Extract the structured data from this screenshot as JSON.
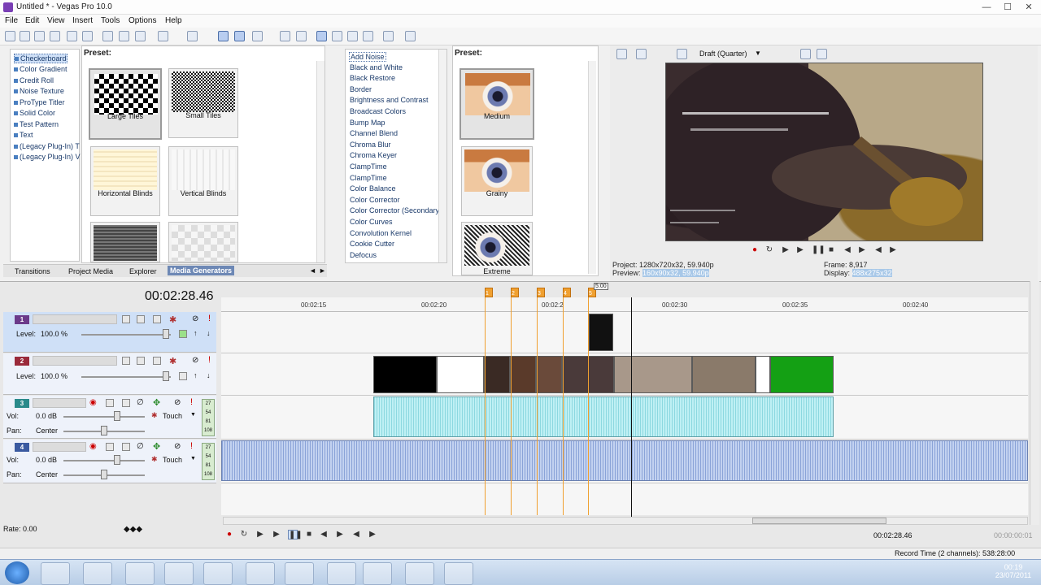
{
  "window": {
    "title": "Untitled * - Vegas Pro 10.0",
    "minimize": "—",
    "maximize": "☐",
    "close": "✕"
  },
  "menu": [
    "File",
    "Edit",
    "View",
    "Insert",
    "Tools",
    "Options",
    "Help"
  ],
  "generators_tree": [
    "Checkerboard",
    "Color Gradient",
    "Credit Roll",
    "Noise Texture",
    "ProType Titler",
    "Solid Color",
    "Test Pattern",
    "Text",
    "(Legacy Plug-In) T",
    "(Legacy Plug-In) V"
  ],
  "generators_preset_label": "Preset:",
  "generator_presets": [
    "Large Tiles",
    "Small Tiles",
    "Horizontal Blinds",
    "Vertical Blinds"
  ],
  "tabs": [
    "Transitions",
    "Project Media",
    "Explorer",
    "Media Generators"
  ],
  "fx_list": [
    "Add Noise",
    "Black and White",
    "Black Restore",
    "Border",
    "Brightness and Contrast",
    "Broadcast Colors",
    "Bump Map",
    "Channel Blend",
    "Chroma Blur",
    "Chroma Keyer",
    "ClampTime",
    "ClampTime",
    "Color Balance",
    "Color Corrector",
    "Color Corrector (Secondary)",
    "Color Curves",
    "Convolution Kernel",
    "Cookie Cutter",
    "Defocus",
    "Deform"
  ],
  "fx_preset_label": "Preset:",
  "fx_presets": [
    "Medium",
    "Grainy",
    "Extreme"
  ],
  "preview": {
    "quality": "Draft (Quarter)",
    "project_label": "Project:",
    "project_value": "1280x720x32, 59.940p",
    "preview_label": "Preview:",
    "preview_value": "160x90x32, 59.940p",
    "frame_label": "Frame:",
    "frame_value": "8,917",
    "display_label": "Display:",
    "display_value": "488x275x32"
  },
  "timeline": {
    "timecode": "00:02:28.46",
    "ruler": [
      "00:02:15",
      "00:02:20",
      "00:02:2",
      "00:02:30",
      "00:02:35",
      "00:02:40"
    ],
    "markers": [
      "1",
      "2",
      "3",
      "4",
      "5"
    ],
    "playhead_label": "5:00"
  },
  "tracks": [
    {
      "num": "1",
      "color": "#6b3a8a",
      "label1": "Level:",
      "value1": "100.0 %"
    },
    {
      "num": "2",
      "color": "#9a2a3a",
      "label1": "Level:",
      "value1": "100.0 %"
    },
    {
      "num": "3",
      "color": "#2a8a8a",
      "label1": "Vol:",
      "value1": "0.0 dB",
      "label2": "Pan:",
      "value2": "Center",
      "mode": "Touch"
    },
    {
      "num": "4",
      "color": "#3a5aa0",
      "label1": "Vol:",
      "value1": "0.0 dB",
      "label2": "Pan:",
      "value2": "Center",
      "mode": "Touch"
    }
  ],
  "meter_levels": [
    "27",
    "54",
    "81",
    "108"
  ],
  "rate": "Rate: 0.00",
  "transport_timecode": "00:02:28.46",
  "transport_timecode2": "00:00:00:01",
  "record_time": "Record Time (2 channels): 538:28:00",
  "clock": {
    "time": "00:19",
    "date": "23/07/2011"
  }
}
